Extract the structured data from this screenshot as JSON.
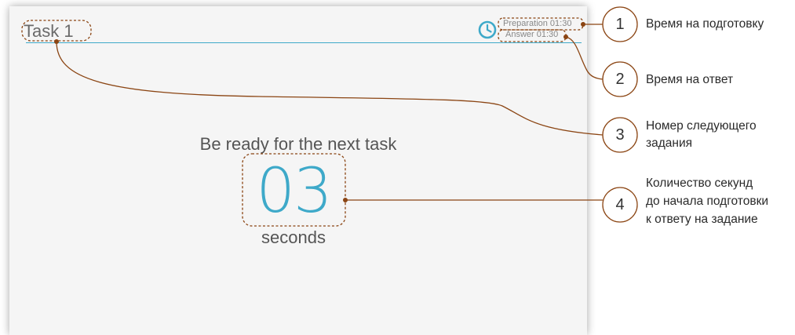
{
  "app": {
    "task_title": "Task 1",
    "preparation_time": "Preparation 01:30",
    "answer_time": "Answer 01:30",
    "ready_message": "Be ready for the next task",
    "countdown_value": "03",
    "countdown_unit": "seconds"
  },
  "colors": {
    "accent": "#3ea9c9",
    "annotation": "#8b4513"
  },
  "callouts": [
    {
      "number": "1",
      "label": "Время на подготовку"
    },
    {
      "number": "2",
      "label": "Время на ответ"
    },
    {
      "number": "3",
      "label_line1": "Номер следующего",
      "label_line2": "задания"
    },
    {
      "number": "4",
      "label_line1": "Количество секунд",
      "label_line2": "до начала подготовки",
      "label_line3": "к ответу на задание"
    }
  ]
}
